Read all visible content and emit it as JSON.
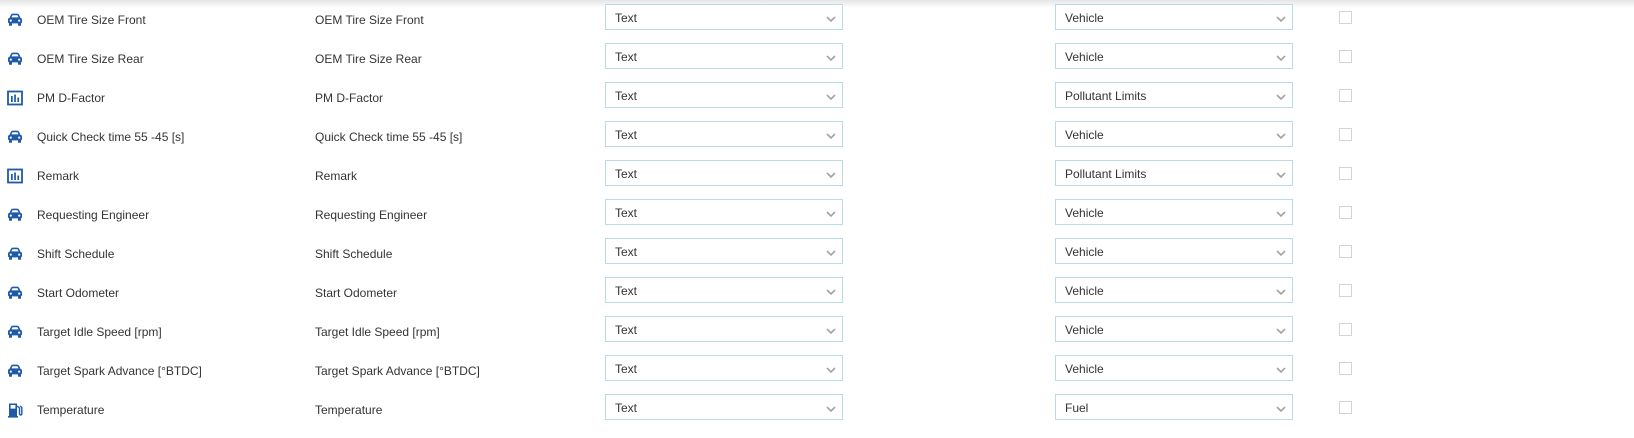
{
  "colors": {
    "icon_blue": "#1f5aa8",
    "select_border": "#bcd9e6",
    "chevron": "#a3a3a3",
    "checkbox_border": "#d4d4d4"
  },
  "rows": [
    {
      "icon": "car-icon",
      "name": "OEM Tire Size Front",
      "label": "OEM Tire Size Front",
      "type": "Text",
      "category": "Vehicle",
      "checked": false
    },
    {
      "icon": "car-icon",
      "name": "OEM Tire Size Rear",
      "label": "OEM Tire Size Rear",
      "type": "Text",
      "category": "Vehicle",
      "checked": false
    },
    {
      "icon": "bar-chart-icon",
      "name": "PM D-Factor",
      "label": "PM D-Factor",
      "type": "Text",
      "category": "Pollutant Limits",
      "checked": false
    },
    {
      "icon": "car-icon",
      "name": "Quick Check time 55 -45 [s]",
      "label": "Quick Check time 55 -45 [s]",
      "type": "Text",
      "category": "Vehicle",
      "checked": false
    },
    {
      "icon": "bar-chart-icon",
      "name": "Remark",
      "label": "Remark",
      "type": "Text",
      "category": "Pollutant Limits",
      "checked": false
    },
    {
      "icon": "car-icon",
      "name": "Requesting Engineer",
      "label": "Requesting Engineer",
      "type": "Text",
      "category": "Vehicle",
      "checked": false
    },
    {
      "icon": "car-icon",
      "name": "Shift Schedule",
      "label": "Shift Schedule",
      "type": "Text",
      "category": "Vehicle",
      "checked": false
    },
    {
      "icon": "car-icon",
      "name": "Start Odometer",
      "label": "Start Odometer",
      "type": "Text",
      "category": "Vehicle",
      "checked": false
    },
    {
      "icon": "car-icon",
      "name": "Target Idle Speed [rpm]",
      "label": "Target Idle Speed [rpm]",
      "type": "Text",
      "category": "Vehicle",
      "checked": false
    },
    {
      "icon": "car-icon",
      "name": "Target Spark Advance [°BTDC]",
      "label": "Target Spark Advance [°BTDC]",
      "type": "Text",
      "category": "Vehicle",
      "checked": false
    },
    {
      "icon": "fuel-pump-icon",
      "name": "Temperature",
      "label": "Temperature",
      "type": "Text",
      "category": "Fuel",
      "checked": false
    }
  ]
}
